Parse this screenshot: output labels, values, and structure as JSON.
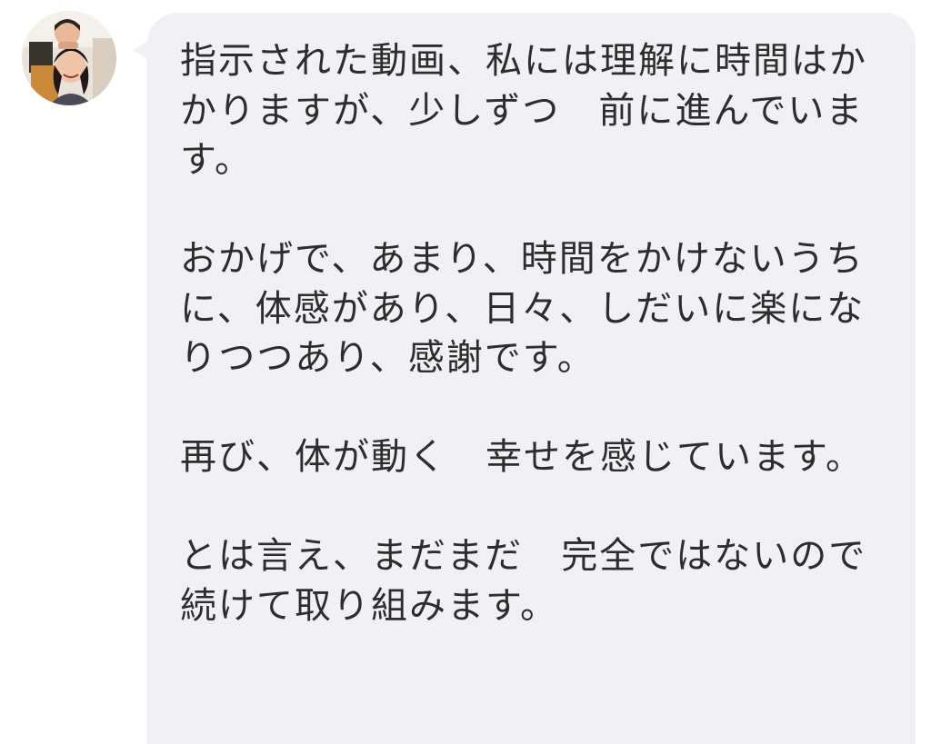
{
  "sender": {
    "avatar_icon": "user-avatar-photo"
  },
  "message": {
    "bubble_color": "#f0f1f4",
    "text_color": "#2d2d2d",
    "paragraphs": [
      "指示された動画、私には理解に時間はかかりますが、少しずつ　前に進んでいます。",
      "おかげで、あまり、時間をかけないうちに、体感があり、日々、しだいに楽になりつつあり、感謝です。",
      "再び、体が動く　幸せを感じています。",
      "とは言え、まだまだ　完全ではないので続けて取り組みます。"
    ]
  }
}
